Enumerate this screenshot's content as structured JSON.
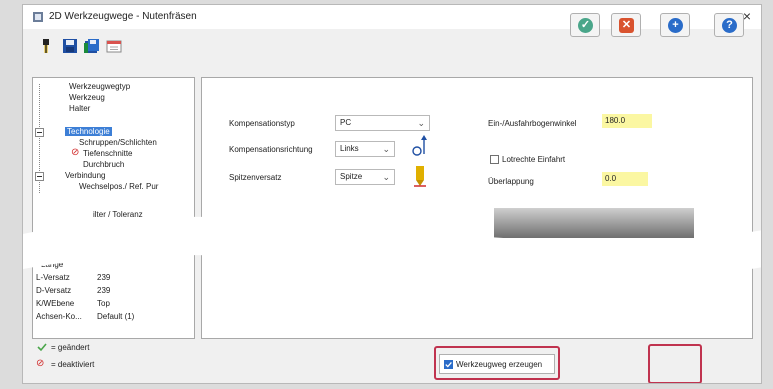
{
  "window": {
    "title": "2D Werkzeugwege - Nutenfräsen",
    "close_glyph": "×"
  },
  "toolbar": {
    "icons": [
      "tool-icon",
      "save-icon",
      "save-all-icon",
      "calendar-icon"
    ]
  },
  "tree": {
    "items": [
      {
        "label": "Werkzeugwegtyp"
      },
      {
        "label": "Werkzeug"
      },
      {
        "label": "Halter"
      },
      {
        "label": "Technologie"
      },
      {
        "label": "Schruppen/Schlichten"
      },
      {
        "label": "Tiefenschnitte"
      },
      {
        "label": "Durchbruch"
      },
      {
        "label": "Verbindung"
      },
      {
        "label": "Wechselpos./ Ref. Pur"
      },
      {
        "label": "ilter / Toleranz"
      },
      {
        "label": "Lange"
      }
    ],
    "props": [
      {
        "label": "L-Versatz",
        "value": "239"
      },
      {
        "label": "D-Versatz",
        "value": "239"
      },
      {
        "label": "K/WEbene",
        "value": "Top"
      },
      {
        "label": "Achsen-Ko...",
        "value": "Default (1)"
      }
    ]
  },
  "legend": {
    "changed": "= geändert",
    "disabled": "= deaktiviert"
  },
  "form": {
    "komp_typ_label": "Kompensationstyp",
    "komp_typ_value": "PC",
    "komp_richtung_label": "Kompensationsrichtung",
    "komp_richtung_value": "Links",
    "spitzen_label": "Spitzenversatz",
    "spitzen_value": "Spitze",
    "bogen_label": "Ein-/Ausfahrbogenwinkel",
    "bogen_value": "180.0",
    "lotrecht_label": "Lotrechte Einfahrt",
    "ueberlappung_label": "Überlappung",
    "ueberlappung_value": "0.0"
  },
  "bottom": {
    "werkzeugweg_label": "Werkzeugweg erzeugen",
    "werkzeugweg_checked": true
  },
  "colors": {
    "selection": "#3d7fd6",
    "highlight_field": "#fbf7a2",
    "outline": "#c0334f"
  }
}
